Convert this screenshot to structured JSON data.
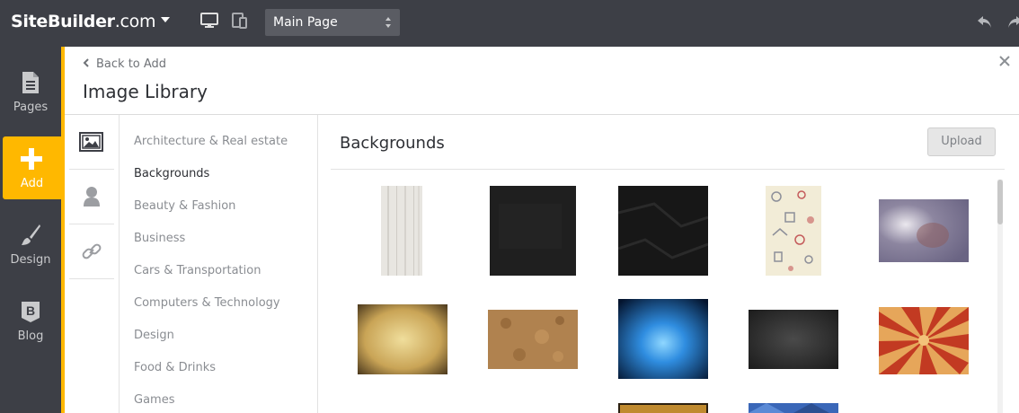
{
  "topbar": {
    "brand_name": "SiteBuilder",
    "brand_suffix": ".com",
    "page_select_value": "Main Page"
  },
  "leftnav": {
    "items": [
      {
        "label": "Pages"
      },
      {
        "label": "Add"
      },
      {
        "label": "Design"
      },
      {
        "label": "Blog"
      }
    ]
  },
  "panel": {
    "back_label": "Back to Add",
    "title": "Image Library"
  },
  "categories": [
    "Architecture & Real estate",
    "Backgrounds",
    "Beauty & Fashion",
    "Business",
    "Cars & Transportation",
    "Computers & Technology",
    "Design",
    "Food & Drinks",
    "Games"
  ],
  "content": {
    "title": "Backgrounds",
    "upload_label": "Upload"
  },
  "colors": {
    "accent": "#ffb800",
    "topbar": "#3d3f46"
  }
}
